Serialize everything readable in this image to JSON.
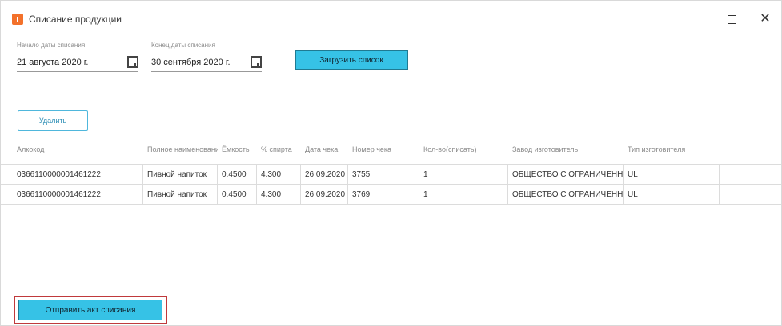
{
  "window": {
    "title": "Списание продукции"
  },
  "filters": {
    "date_from": {
      "caption": "Начало даты списания",
      "value": "21 августа 2020 г."
    },
    "date_to": {
      "caption": "Конец даты списания",
      "value": "30 сентября 2020 г."
    },
    "load_label": "Загрузить список"
  },
  "actions": {
    "delete_label": "Удалить",
    "send_label": "Отправить акт списания"
  },
  "table": {
    "columns": [
      "Алкокод",
      "Полное наименование",
      "Ёмкость",
      "% спирта",
      "Дата чека",
      "Номер чека",
      "Кол-во(списать)",
      "Завод изготовитель",
      "Тип изготовителя"
    ],
    "rows": [
      [
        "0366110000001461222",
        "Пивной напиток",
        "0.4500",
        "4.300",
        "26.09.2020",
        "3755",
        "1",
        "ОБЩЕСТВО С ОГРАНИЧЕННОЙ",
        "UL"
      ],
      [
        "0366110000001461222",
        "Пивной напиток",
        "0.4500",
        "4.300",
        "26.09.2020",
        "3769",
        "1",
        "ОБЩЕСТВО С ОГРАНИЧЕННОЙ",
        "UL"
      ]
    ]
  },
  "colors": {
    "accent": "#36c2e6",
    "highlight": "#c0393b",
    "app_icon": "#f3712b"
  }
}
